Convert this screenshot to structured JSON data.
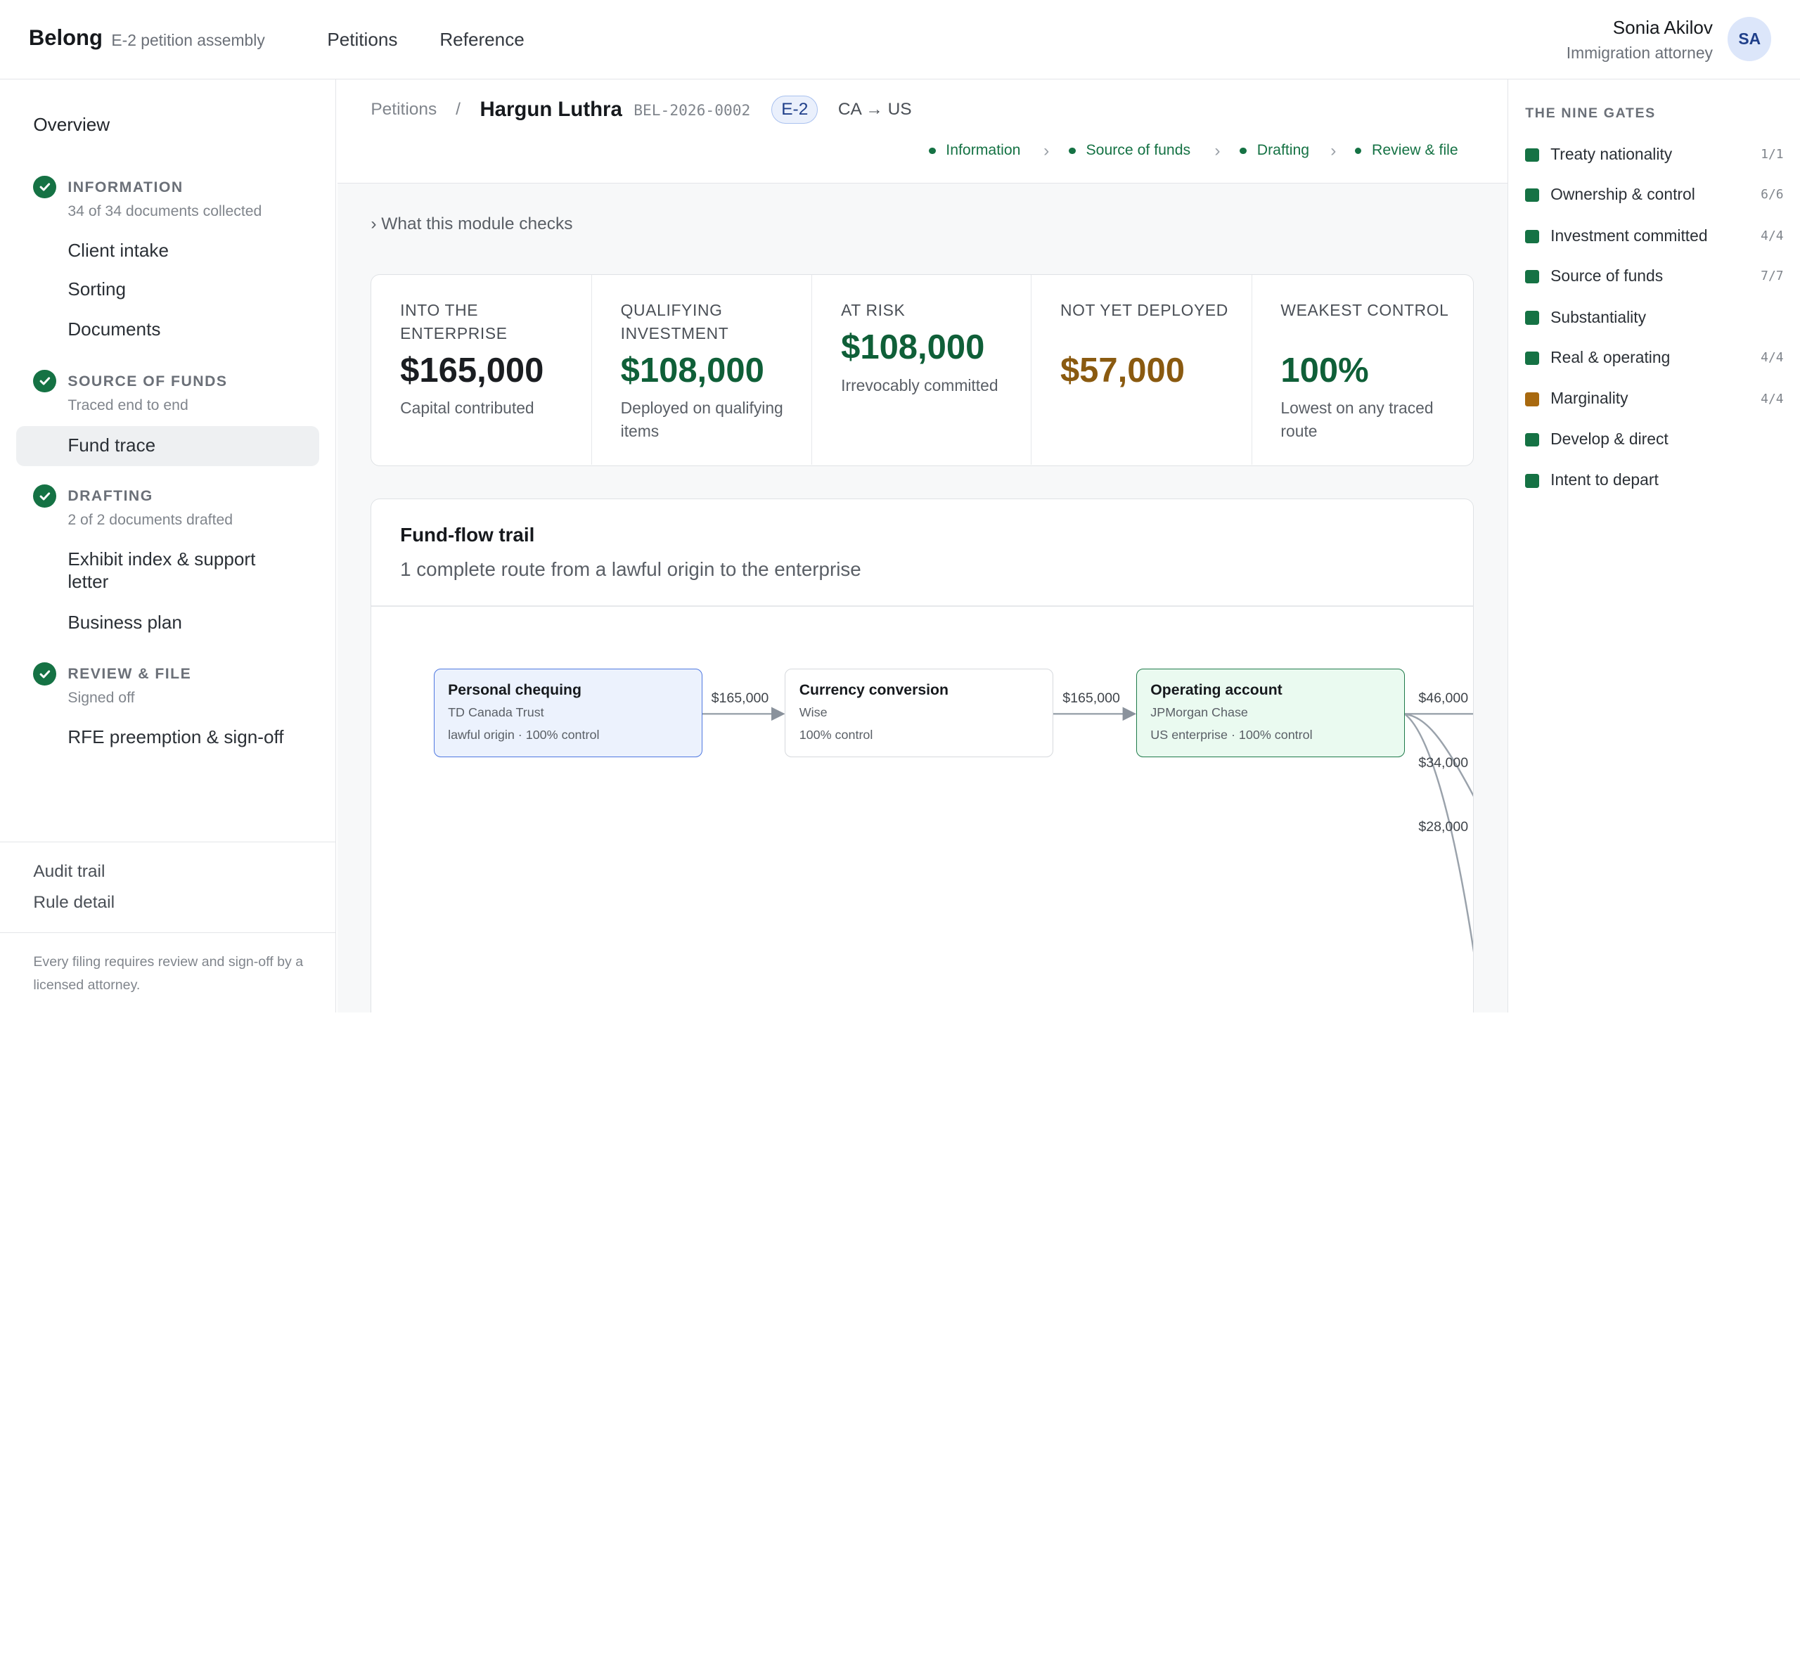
{
  "brand": {
    "name": "Belong",
    "subtitle": "E-2 petition assembly"
  },
  "top_nav": [
    {
      "label": "Petitions"
    },
    {
      "label": "Reference"
    }
  ],
  "user": {
    "name": "Sonia Akilov",
    "role": "Immigration attorney",
    "initials": "SA"
  },
  "sidebar": {
    "overview": "Overview",
    "sections": [
      {
        "title": "INFORMATION",
        "subtitle": "34 of 34 documents collected",
        "items": [
          "Client intake",
          "Sorting",
          "Documents"
        ]
      },
      {
        "title": "SOURCE OF FUNDS",
        "subtitle": "Traced end to end",
        "items": [
          "Fund trace"
        ]
      },
      {
        "title": "DRAFTING",
        "subtitle": "2 of 2 documents drafted",
        "items": [
          "Exhibit index & support letter",
          "Business plan"
        ]
      },
      {
        "title": "REVIEW & FILE",
        "subtitle": "Signed off",
        "items": [
          "RFE preemption & sign-off"
        ]
      }
    ],
    "active_item": "Fund trace",
    "footer_links": [
      "Audit trail",
      "Rule detail"
    ],
    "footer_note": "Every filing requires review and sign-off by a licensed attorney."
  },
  "breadcrumb": {
    "root": "Petitions",
    "separator": "/",
    "client": "Hargun Luthra",
    "case_id": "BEL-2026-0002",
    "visa": "E-2",
    "route": "CA → US"
  },
  "stepper": {
    "separator": "›",
    "steps": [
      "Information",
      "Source of funds",
      "Drafting",
      "Review & file"
    ]
  },
  "module_toggle": "› What this module checks",
  "kpis": [
    {
      "label": "INTO THE ENTERPRISE",
      "value": "$165,000",
      "note": "Capital contributed",
      "color": "#1a1d21"
    },
    {
      "label": "QUALIFYING INVESTMENT",
      "value": "$108,000",
      "note": "Deployed on qualifying items",
      "color": "#0f5f38"
    },
    {
      "label": "AT RISK",
      "value": "$108,000",
      "note": "Irrevocably committed",
      "color": "#0f5f38"
    },
    {
      "label": "NOT YET DEPLOYED",
      "value": "$57,000",
      "note": "",
      "color": "#8a5a10"
    },
    {
      "label": "WEAKEST CONTROL",
      "value": "100%",
      "note": "Lowest on any traced route",
      "color": "#0f5f38"
    }
  ],
  "fund_flow": {
    "title": "Fund-flow trail",
    "subtitle": "1 complete route from a lawful origin to the enterprise",
    "nodes": [
      {
        "title": "Personal chequing",
        "line1": "TD Canada Trust",
        "line2": "lawful origin · 100% control"
      },
      {
        "title": "Currency conversion",
        "line1": "Wise",
        "line2": "100% control"
      },
      {
        "title": "Operating account",
        "line1": "JPMorgan Chase",
        "line2": "US enterprise · 100% control"
      }
    ],
    "edges": [
      "$165,000",
      "$165,000"
    ],
    "outflows": [
      "$46,000",
      "$34,000",
      "$28,000"
    ]
  },
  "gates": {
    "title": "THE NINE GATES",
    "items": [
      {
        "name": "Treaty nationality",
        "count": "1/1",
        "status_color": "#157244"
      },
      {
        "name": "Ownership & control",
        "count": "6/6",
        "status_color": "#157244"
      },
      {
        "name": "Investment committed",
        "count": "4/4",
        "status_color": "#157244"
      },
      {
        "name": "Source of funds",
        "count": "7/7",
        "status_color": "#157244"
      },
      {
        "name": "Substantiality",
        "count": "",
        "status_color": "#157244"
      },
      {
        "name": "Real & operating",
        "count": "4/4",
        "status_color": "#157244"
      },
      {
        "name": "Marginality",
        "count": "4/4",
        "status_color": "#a8690f"
      },
      {
        "name": "Develop & direct",
        "count": "",
        "status_color": "#157244"
      },
      {
        "name": "Intent to depart",
        "count": "",
        "status_color": "#157244"
      }
    ]
  }
}
